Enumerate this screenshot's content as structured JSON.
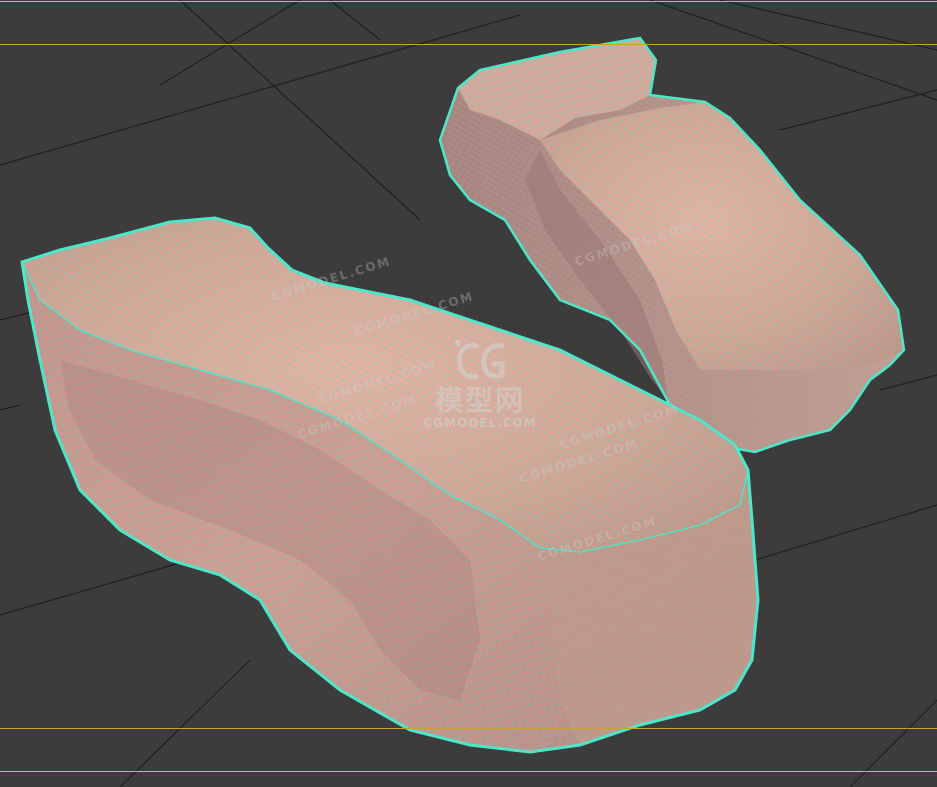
{
  "viewport": {
    "background_color": "#3c3c3c",
    "grid_color": "#1e1e1e",
    "wireframe_color": "#46e0c4",
    "surface_color": "#e4a898",
    "safe_frame_color": "#c9a227",
    "frame_edge_color": "#5fd9cc"
  },
  "objects": [
    {
      "name": "stone-block-large"
    },
    {
      "name": "stone-block-small"
    }
  ],
  "watermark": {
    "logo_icon": "cgmodel-logo-icon",
    "chinese": "模型网",
    "english": "CGMODEL.COM",
    "repeat": [
      "CGMODEL.COM",
      "CGMODEL.COM",
      "CGMODEL.COM",
      "CGMODEL.COM",
      "CGMODEL.COM",
      "CGMODEL.COM",
      "CGMODEL.COM",
      "CGMODEL.COM"
    ]
  }
}
